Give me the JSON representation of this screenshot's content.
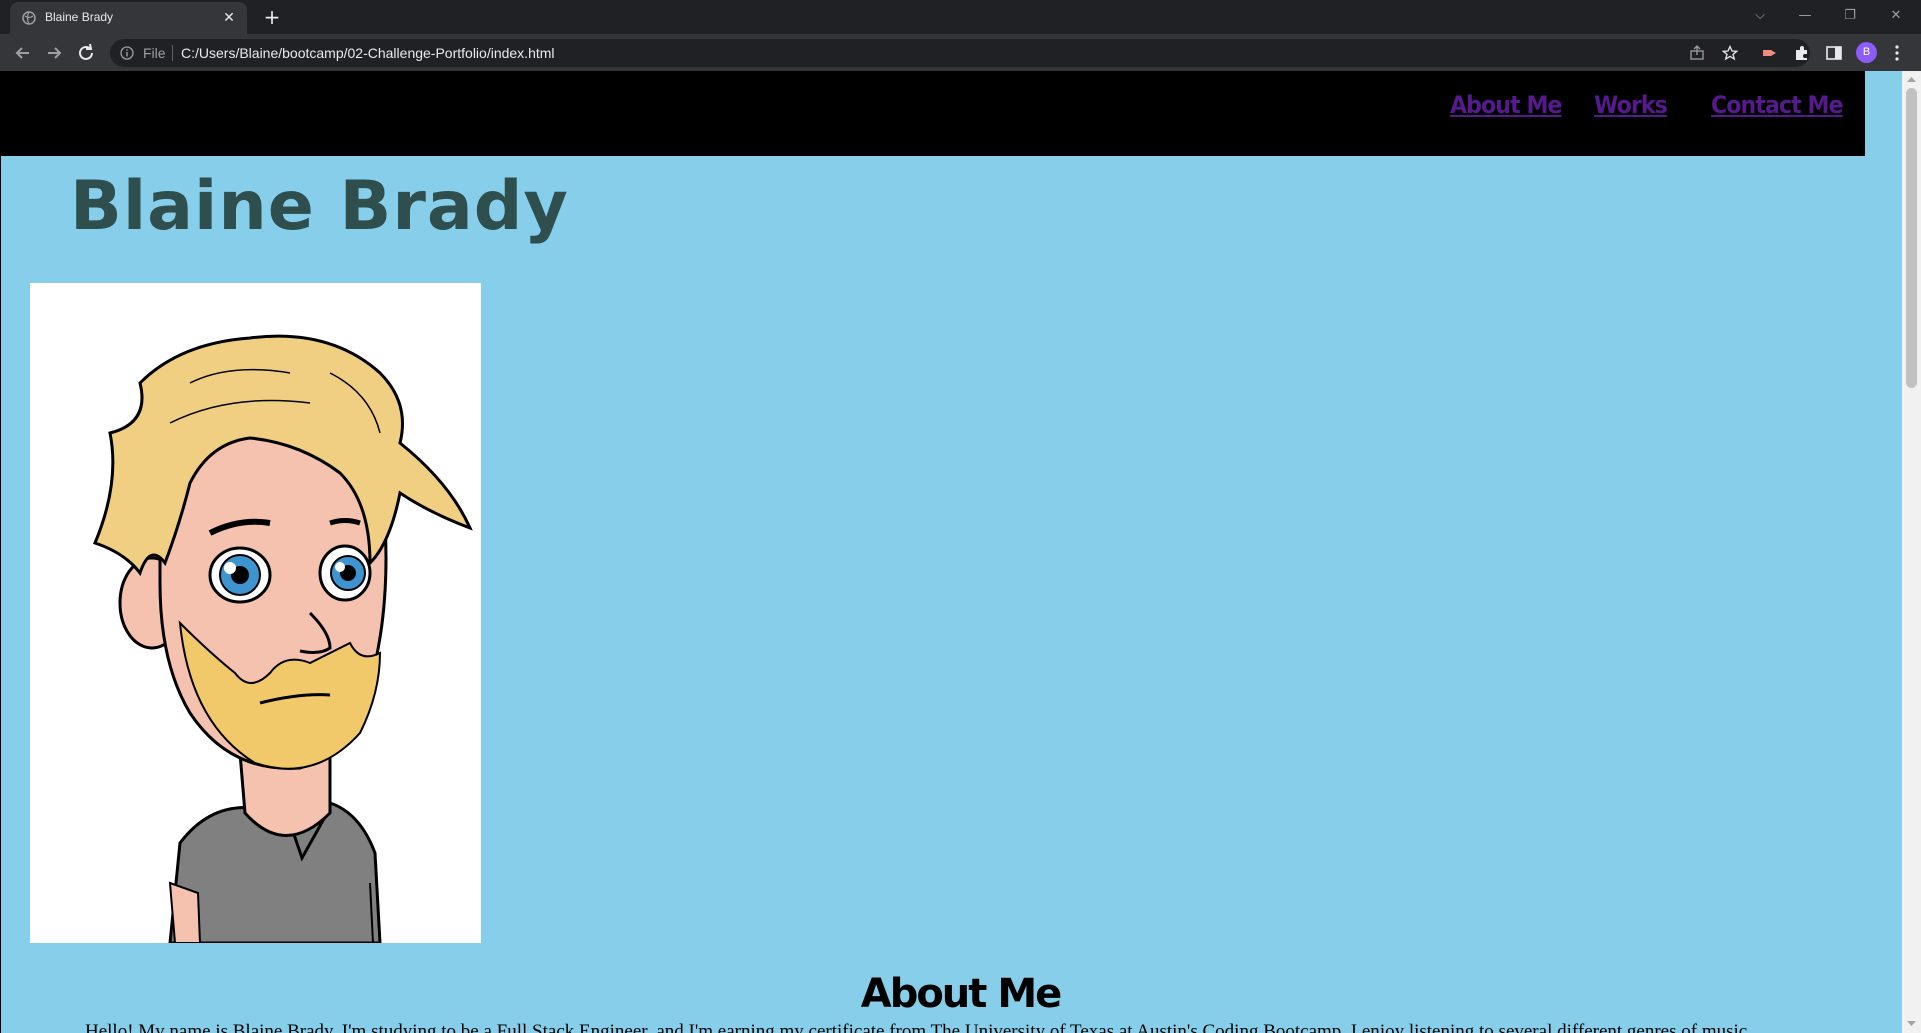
{
  "browser": {
    "tab_title": "Blaine Brady",
    "new_tab": "+",
    "close_tab": "✕",
    "file_label": "File",
    "url": "C:/Users/Blaine/bootcamp/02-Challenge-Portfolio/index.html",
    "profile_initial": "B"
  },
  "page": {
    "nav": [
      "About Me",
      "Works",
      "Contact Me"
    ],
    "title": "Blaine Brady",
    "about_heading": "About Me",
    "about_text": "Hello! My name is Blaine Brady. I'm studying to be a Full Stack Engineer, and I'm earning my certificate from The University of Texas at Austin's Coding Bootcamp. I enjoy listening to several different genres of music",
    "colors": {
      "background": "#87ceea",
      "header": "#000000",
      "title": "#2f4f4f",
      "link": "#551a8b"
    }
  }
}
